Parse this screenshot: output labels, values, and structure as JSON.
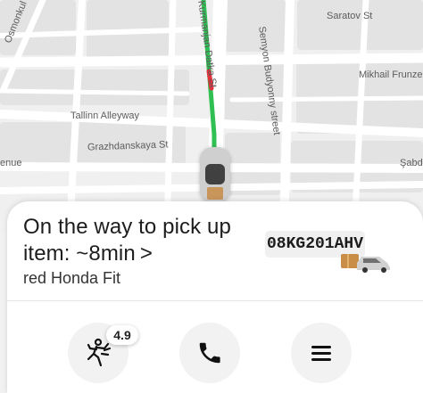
{
  "map": {
    "streets": {
      "osmonkul": "Osmonkul St",
      "kurmanjan": "Kurmanjan Datka St",
      "saratov": "Saratov St",
      "semyon": "Semyon Budyonny street",
      "mikhail": "Mikhail Frunze St",
      "tallinn": "Tallinn Alleyway",
      "grazhdan": "Grazhdanskaya St",
      "enue": "enue",
      "shabd": "Şabd"
    },
    "route_color": "#2fbf52"
  },
  "trip": {
    "title": "On the way to pick up item: ~8min",
    "title_arrow": ">",
    "car_description": "red Honda Fit",
    "plate": "08KG201AHV"
  },
  "driver": {
    "rating": "4.9"
  },
  "actions": {
    "courier": "courier-icon",
    "call": "phone-icon",
    "menu": "menu-icon"
  }
}
